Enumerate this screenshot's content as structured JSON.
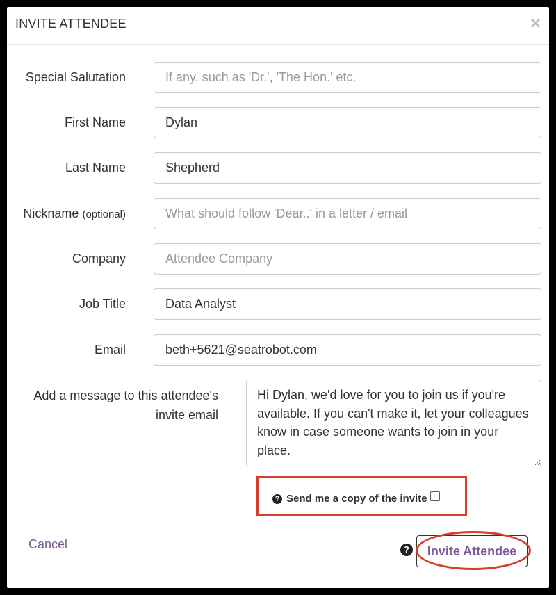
{
  "dialog": {
    "title": "INVITE ATTENDEE",
    "close_label": "×"
  },
  "fields": {
    "salutation": {
      "label": "Special Salutation",
      "value": "",
      "placeholder": "If any, such as 'Dr.', 'The Hon.' etc."
    },
    "first_name": {
      "label": "First Name",
      "value": "Dylan",
      "placeholder": ""
    },
    "last_name": {
      "label": "Last Name",
      "value": "Shepherd",
      "placeholder": ""
    },
    "nickname": {
      "label": "Nickname",
      "label_suffix": "(optional)",
      "value": "",
      "placeholder": "What should follow 'Dear..' in a letter / email"
    },
    "company": {
      "label": "Company",
      "value": "",
      "placeholder": "Attendee Company"
    },
    "job_title": {
      "label": "Job Title",
      "value": "Data Analyst",
      "placeholder": ""
    },
    "email": {
      "label": "Email",
      "value": "beth+5621@seatrobot.com",
      "placeholder": ""
    }
  },
  "message": {
    "label": "Add a message to this attendee's invite email",
    "value": "Hi Dylan, we'd love for you to join us if you're available. If you can't make it, let your colleagues know in case someone wants to join in your place."
  },
  "copy_option": {
    "label": "Send me a copy of the invite",
    "checked": false,
    "help_glyph": "?"
  },
  "footer": {
    "cancel_label": "Cancel",
    "help_glyph": "?",
    "invite_label": "Invite Attendee"
  },
  "colors": {
    "accent": "#7b5b95",
    "highlight": "#d6402a"
  }
}
